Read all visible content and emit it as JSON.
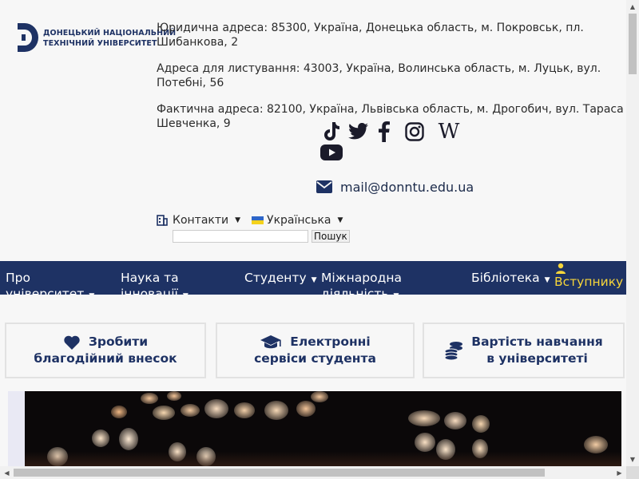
{
  "logo": {
    "line1": "ДОНЕЦЬКИЙ НАЦІОНАЛЬНИЙ",
    "line2": "ТЕХНІЧНИЙ УНІВЕРСИТЕТ",
    "brand_color": "#1e3264"
  },
  "addresses": {
    "legal": "Юридична адреса: 85300, Україна, Донецька область, м. Покровськ, пл. Шибанкова, 2",
    "postal": "Адреса для листування: 43003, Україна, Волинська область, м. Луцьк, вул. Потебні, 56",
    "actual": "Фактична адреса: 82100, Україна, Львівська область, м. Дрогобич, вул. Тараса Шевченка, 9"
  },
  "social": [
    {
      "icon": "tiktok-icon"
    },
    {
      "icon": "twitter-icon"
    },
    {
      "icon": "facebook-icon"
    },
    {
      "icon": "instagram-icon"
    },
    {
      "icon": "wikipedia-icon"
    },
    {
      "icon": "youtube-icon"
    }
  ],
  "contact": {
    "email": "mail@donntu.edu.ua",
    "icon": "envelope-icon"
  },
  "links": {
    "contacts_label": "Контакти",
    "language_label": "Українська"
  },
  "search": {
    "value": "",
    "button_label": "Пошук"
  },
  "nav": {
    "items": [
      {
        "label": "Про університет"
      },
      {
        "label": "Наука та інновації"
      },
      {
        "label": "Студенту"
      },
      {
        "label": "Міжнародна діяльність"
      },
      {
        "label": "Бібліотека"
      },
      {
        "label": "Вступнику"
      }
    ],
    "background": "#1e3264",
    "highlight": "#f6d53a"
  },
  "quick": [
    {
      "line1": "Зробити",
      "line2": "благодійний внесок",
      "icon": "heart-icon"
    },
    {
      "line1": "Електронні",
      "line2": "сервіси студента",
      "icon": "graduation-cap-icon"
    },
    {
      "line1": "Вартість навчання",
      "line2": "в університеті",
      "icon": "coins-icon"
    }
  ]
}
